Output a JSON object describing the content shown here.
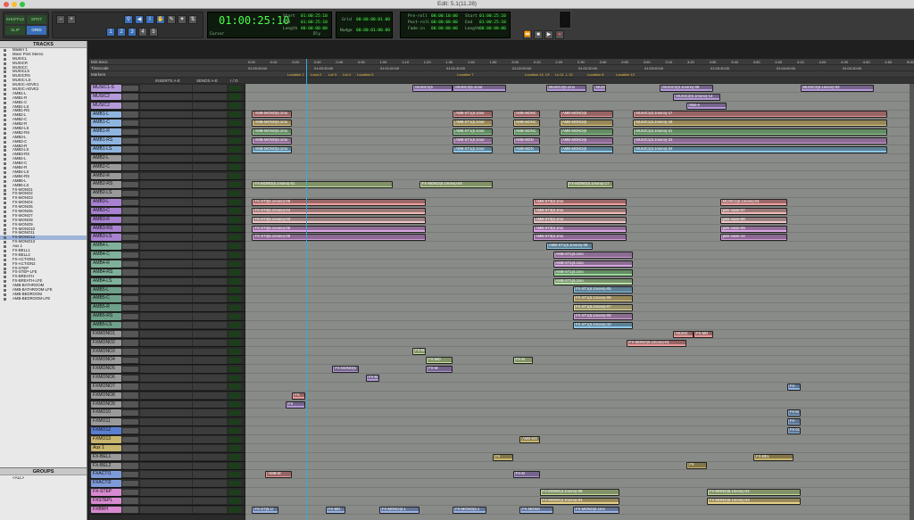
{
  "window": {
    "title": "Edit: 5.1(11.28)"
  },
  "toolbar": {
    "mode_buttons": [
      "SHUFFLE",
      "SPOT",
      "SLIP",
      "GRID"
    ],
    "counter_main": "01:00:25:10",
    "counter_label": "Cursor",
    "sel": {
      "start_label": "Start",
      "end_label": "End",
      "length_label": "Length",
      "start": "01:00:25:10",
      "end": "01:00:25:10",
      "length": "00:00:00:00"
    },
    "dly_label": "Dly",
    "grid_label": "Grid",
    "nudge_label": "Nudge",
    "nudge_value": "00:00:01:00.00",
    "grid_value": "00:00:00:01.00",
    "preroll": {
      "pre_label": "Pre-roll",
      "post_label": "Post-roll",
      "fade_label": "Fade-in",
      "pre": "00:00:10:00",
      "post": "00:00:00:00",
      "fade": "00:00:00:00"
    },
    "transport_sel": {
      "start": "01:00:25:10",
      "end": "01:00:25:10",
      "length": "00:00:00:00"
    }
  },
  "tracks_panel": {
    "header": "TRACKS",
    "items": [
      "Master 1",
      "Mixer Print Stereo",
      "MUSICL",
      "MUSICR",
      "MUSICC",
      "MUSICLS",
      "MUSICRS",
      "MUSIC-LS",
      "MUSIC-ADVE1",
      "MUSIC-ADVE2",
      "AMB1-L",
      "AMB1-R",
      "AMB1-C",
      "AMB1-LS",
      "AMB1-RS",
      "AMB2-L",
      "AMB2-C",
      "AMB2-R",
      "AMB2-LS",
      "AMB2-RS",
      "AMB3-L",
      "AMB3-C",
      "AMB3-R",
      "AMB3-LS",
      "AMB3-RS",
      "AMB4-L",
      "AMB4-C",
      "AMB4-R",
      "AMB4-LS",
      "AMB4-RS",
      "AMB5-L",
      "AMB5-LS",
      "FX-MONO1",
      "FX-MONO2",
      "FX-MONO3",
      "FX-MONO4",
      "FX-MONO5",
      "FX-MONO6",
      "FX-MONO7",
      "FX-MONO8",
      "FX-MONO9",
      "FX-MONO10",
      "FX-MONO11",
      "FX-MONO12",
      "FX-MONO13",
      "Aux 1",
      "FX-BELL1",
      "FX-BELL2",
      "FX-ACTION1",
      "FX-ACTION2",
      "FX-STEP",
      "FX-STEP-LFE",
      "FX-BREATH",
      "FX-BREATH-LFE",
      "AMB-BATHROOM",
      "AMB-BATHROOM-LFE",
      "AMB-BEDROOM",
      "AMB-BEDROOM-LFE"
    ],
    "selected": "FX-MONO12"
  },
  "groups_panel": {
    "header": "GROUPS",
    "items": [
      "<ALL>"
    ]
  },
  "rulers": {
    "min_secs_label": "Min:Secs",
    "timecode_label": "Timecode",
    "markers_label": "Markers",
    "min_secs_ticks": [
      "0:00",
      "0:10",
      "0:20",
      "0:30",
      "0:40",
      "0:50",
      "1:00",
      "1:10",
      "1:20",
      "1:30",
      "1:40",
      "1:50",
      "2:00",
      "2:10",
      "2:20",
      "2:30",
      "2:40",
      "2:50",
      "3:00",
      "3:10",
      "3:20",
      "3:30",
      "3:40",
      "3:50",
      "4:00",
      "4:10",
      "4:20",
      "4:30",
      "4:40",
      "4:50",
      "5:00"
    ],
    "timecode_ticks": [
      "01:00:00:00",
      "01:00:30:00",
      "01:01:00:00",
      "01:01:30:00",
      "01:02:00:00",
      "01:02:30:00",
      "01:03:00:00",
      "01:03:30:00",
      "01:04:00:00",
      "01:04:30:00"
    ],
    "markers": [
      "Location 1",
      "Loca 2",
      "Lot 3",
      "Lot 4",
      "Location 5",
      "Location 7",
      "Location 14",
      "L9",
      "Lo 11",
      "L 12",
      "Location 8",
      "Location 13"
    ]
  },
  "mixer_headers": {
    "inserts": "INSERTS A-E",
    "sends": "SENDS A-E",
    "io": "I / O"
  },
  "edit_tracks": [
    {
      "name": "MUSIC1-S",
      "color": "#b49ad8"
    },
    {
      "name": "MUSIC2",
      "color": "#b49ad8"
    },
    {
      "name": "MUSIC2",
      "color": "#b49ad8"
    },
    {
      "name": "AMB1-L",
      "color": "#8fb4e0"
    },
    {
      "name": "AMB1-C",
      "color": "#8fb4e0"
    },
    {
      "name": "AMB1-R",
      "color": "#8fb4e0"
    },
    {
      "name": "AMB1-RS",
      "color": "#8fb4e0"
    },
    {
      "name": "AMB1-LS",
      "color": "#8fb4e0"
    },
    {
      "name": "AMB2-L",
      "color": "#9a9a9a"
    },
    {
      "name": "AMB2-C",
      "color": "#9a9a9a"
    },
    {
      "name": "AMB2-R",
      "color": "#9a9a9a"
    },
    {
      "name": "AMB2-RS",
      "color": "#9a9a9a"
    },
    {
      "name": "AMB2-LS",
      "color": "#9a9a9a"
    },
    {
      "name": "AMB3-L",
      "color": "#a882d0"
    },
    {
      "name": "AMB3-C",
      "color": "#a882d0"
    },
    {
      "name": "AMB3-R",
      "color": "#a882d0"
    },
    {
      "name": "AMB3-RS",
      "color": "#a882d0"
    },
    {
      "name": "AMB3-LS",
      "color": "#a882d0"
    },
    {
      "name": "AMB4-L",
      "color": "#7fb09a"
    },
    {
      "name": "AMB4-C",
      "color": "#7fb09a"
    },
    {
      "name": "AMB4-R",
      "color": "#7fb09a"
    },
    {
      "name": "AMB4-RS",
      "color": "#7fb09a"
    },
    {
      "name": "AMB4-LS",
      "color": "#7fb09a"
    },
    {
      "name": "AMB5-L",
      "color": "#6fa08a"
    },
    {
      "name": "AMB5-C",
      "color": "#6fa08a"
    },
    {
      "name": "AMB5-R",
      "color": "#6fa08a"
    },
    {
      "name": "AMB5-RS",
      "color": "#6fa08a"
    },
    {
      "name": "AMB5-LS",
      "color": "#6fa08a"
    },
    {
      "name": "FXMONO1",
      "color": "#9a9a9a"
    },
    {
      "name": "FXMONO2",
      "color": "#9a9a9a"
    },
    {
      "name": "FXMONO3",
      "color": "#9a9a9a"
    },
    {
      "name": "FXMONO4",
      "color": "#9a9a9a"
    },
    {
      "name": "FXMONO5",
      "color": "#9a9a9a"
    },
    {
      "name": "FXMONO6",
      "color": "#9a9a9a"
    },
    {
      "name": "FXMONO7",
      "color": "#9a9a9a"
    },
    {
      "name": "FXMONO8",
      "color": "#9a9a9a"
    },
    {
      "name": "FXMONO9",
      "color": "#9a9a9a"
    },
    {
      "name": "FXMO10",
      "color": "#9a9a9a"
    },
    {
      "name": "FXMO11",
      "color": "#9a9a9a"
    },
    {
      "name": "FXMO12",
      "color": "#5a7fd0"
    },
    {
      "name": "FXMO13",
      "color": "#c8b56e"
    },
    {
      "name": "Aux 1",
      "color": "#c8b56e"
    },
    {
      "name": "FX-BEL1",
      "color": "#9a9a9a"
    },
    {
      "name": "FX-BEL2",
      "color": "#9a9a9a"
    },
    {
      "name": "FXACTI1",
      "color": "#7f9ad8"
    },
    {
      "name": "FXACTI2",
      "color": "#7f9ad8"
    },
    {
      "name": "FX-STEP",
      "color": "#d88ad0"
    },
    {
      "name": "FXSTEPL",
      "color": "#d88ad0"
    },
    {
      "name": "FXBRH",
      "color": "#d88ad0"
    }
  ],
  "clips": [
    {
      "row": 0,
      "start": 0.25,
      "width": 0.06,
      "color": "#b49ad8",
      "label": "MUSIC1(5"
    },
    {
      "row": 0,
      "start": 0.31,
      "width": 0.08,
      "color": "#b49ad8",
      "label": "MUSIC2(5.1mor"
    },
    {
      "row": 0,
      "start": 0.45,
      "width": 0.06,
      "color": "#b49ad8",
      "label": "MUSIC2(5.1mo"
    },
    {
      "row": 0,
      "start": 0.52,
      "width": 0.02,
      "color": "#b49ad8",
      "label": "MUSI"
    },
    {
      "row": 0,
      "start": 0.62,
      "width": 0.08,
      "color": "#b49ad8",
      "label": "MUSIC2(5.1mono)-09"
    },
    {
      "row": 0,
      "start": 0.83,
      "width": 0.11,
      "color": "#b49ad8",
      "label": "MUSIC2(5.1mono)-02"
    },
    {
      "row": 1,
      "start": 0.64,
      "width": 0.07,
      "color": "#b49ad8",
      "label": "MUSIC2(5.1mono)-14"
    },
    {
      "row": 2,
      "start": 0.66,
      "width": 0.06,
      "color": "#b49ad8",
      "label": "Mus-e"
    },
    {
      "row": 3,
      "start": 0.01,
      "width": 0.06,
      "color": "#e89a9a",
      "label": "AMB-MONO(5.1mo"
    },
    {
      "row": 3,
      "start": 0.31,
      "width": 0.06,
      "color": "#e89a9a",
      "label": "AMB-ST1(5.1mor"
    },
    {
      "row": 3,
      "start": 0.4,
      "width": 0.04,
      "color": "#e89a9a",
      "label": "AMB-MONC"
    },
    {
      "row": 3,
      "start": 0.47,
      "width": 0.08,
      "color": "#e89a9a",
      "label": "AMB-MONO(5"
    },
    {
      "row": 3,
      "start": 0.58,
      "width": 0.38,
      "color": "#e89a9a",
      "label": "MUSIC1(5.1mono)-17"
    },
    {
      "row": 4,
      "start": 0.01,
      "width": 0.06,
      "color": "#e8d28a",
      "label": "AMB-MONO(5.1mo"
    },
    {
      "row": 4,
      "start": 0.31,
      "width": 0.06,
      "color": "#e8d28a",
      "label": "AMB-ST1(5.1mor"
    },
    {
      "row": 4,
      "start": 0.4,
      "width": 0.04,
      "color": "#e8d28a",
      "label": "AMB-MONC"
    },
    {
      "row": 4,
      "start": 0.47,
      "width": 0.08,
      "color": "#e8d28a",
      "label": "AMB-MONO(5"
    },
    {
      "row": 4,
      "start": 0.58,
      "width": 0.38,
      "color": "#e8d28a",
      "label": "MUSIC1(5.1mono)-18"
    },
    {
      "row": 5,
      "start": 0.01,
      "width": 0.06,
      "color": "#9ad89a",
      "label": "AMB-MONO(5.1mo"
    },
    {
      "row": 5,
      "start": 0.31,
      "width": 0.06,
      "color": "#9ad89a",
      "label": "AMB-ST1(5.1mor"
    },
    {
      "row": 5,
      "start": 0.4,
      "width": 0.04,
      "color": "#9ad89a",
      "label": "AMB-MONC"
    },
    {
      "row": 5,
      "start": 0.47,
      "width": 0.08,
      "color": "#9ad89a",
      "label": "AMB-MONO(5"
    },
    {
      "row": 5,
      "start": 0.58,
      "width": 0.38,
      "color": "#9ad89a",
      "label": "MUSIC1(5.1mono)-21"
    },
    {
      "row": 6,
      "start": 0.01,
      "width": 0.06,
      "color": "#d8a8e0",
      "label": "AMB-MONO(5.1mo"
    },
    {
      "row": 6,
      "start": 0.31,
      "width": 0.06,
      "color": "#d8a8e0",
      "label": "AMB-ST1(5.1mor"
    },
    {
      "row": 6,
      "start": 0.4,
      "width": 0.04,
      "color": "#d8a8e0",
      "label": "AMB-MON"
    },
    {
      "row": 6,
      "start": 0.47,
      "width": 0.08,
      "color": "#d8a8e0",
      "label": "AMB-MONO(5"
    },
    {
      "row": 6,
      "start": 0.58,
      "width": 0.38,
      "color": "#d8a8e0",
      "label": "MUSIC1(5.1mono)-22"
    },
    {
      "row": 7,
      "start": 0.01,
      "width": 0.06,
      "color": "#8fc8e8",
      "label": "AMB-MONO(5.1mo"
    },
    {
      "row": 7,
      "start": 0.31,
      "width": 0.06,
      "color": "#8fc8e8",
      "label": "AMB-ST1(5.1mor"
    },
    {
      "row": 7,
      "start": 0.4,
      "width": 0.04,
      "color": "#8fc8e8",
      "label": "AMB-MON"
    },
    {
      "row": 7,
      "start": 0.47,
      "width": 0.08,
      "color": "#8fc8e8",
      "label": "AMB-MONO(5"
    },
    {
      "row": 7,
      "start": 0.58,
      "width": 0.38,
      "color": "#8fc8e8",
      "label": "MUSIC1(5.1mono)-24"
    },
    {
      "row": 11,
      "start": 0.01,
      "width": 0.21,
      "color": "#c8e0a0",
      "label": "FX-MONO(5.1mono)-01"
    },
    {
      "row": 11,
      "start": 0.26,
      "width": 0.11,
      "color": "#c8e0a0",
      "label": "FX-MONO(5.1mono)-04"
    },
    {
      "row": 11,
      "start": 0.48,
      "width": 0.07,
      "color": "#c8e0a0",
      "label": "FX-MONO(5.1mono)-17"
    },
    {
      "row": 13,
      "start": 0.01,
      "width": 0.26,
      "color": "#f0a0a0",
      "label": "FX-ST3(5.1mono)-09"
    },
    {
      "row": 13,
      "start": 0.43,
      "width": 0.14,
      "color": "#f0a0a0",
      "label": "AMB-ST3(5.1mo"
    },
    {
      "row": 13,
      "start": 0.71,
      "width": 0.1,
      "color": "#f0a0a0",
      "label": "MUSIC1(5.1mono)-01"
    },
    {
      "row": 14,
      "start": 0.01,
      "width": 0.26,
      "color": "#f0b8b8",
      "label": "FX-ST3(5.1mono)-04"
    },
    {
      "row": 14,
      "start": 0.43,
      "width": 0.14,
      "color": "#f0b8b8",
      "label": "AMB-ST3(5.1mo"
    },
    {
      "row": 14,
      "start": 0.71,
      "width": 0.1,
      "color": "#f0b8b8",
      "label": "pink noise-07"
    },
    {
      "row": 15,
      "start": 0.01,
      "width": 0.26,
      "color": "#f0c8c8",
      "label": "FX-ST3(5.1mono)-03"
    },
    {
      "row": 15,
      "start": 0.43,
      "width": 0.14,
      "color": "#f0c8c8",
      "label": "AMB-ST3(5.1mo"
    },
    {
      "row": 15,
      "start": 0.71,
      "width": 0.1,
      "color": "#f0c8c8",
      "label": "pink noise-08"
    },
    {
      "row": 16,
      "start": 0.01,
      "width": 0.26,
      "color": "#e0a8e8",
      "label": "FX-ST3(5.1mono)-05"
    },
    {
      "row": 16,
      "start": 0.43,
      "width": 0.14,
      "color": "#e0a8e8",
      "label": "AMB-ST3(5.1mo"
    },
    {
      "row": 16,
      "start": 0.71,
      "width": 0.1,
      "color": "#e0a8e8",
      "label": "pink noise-09"
    },
    {
      "row": 17,
      "start": 0.01,
      "width": 0.26,
      "color": "#d8a0e0",
      "label": "FX-ST3(5.1mono)-06"
    },
    {
      "row": 17,
      "start": 0.43,
      "width": 0.14,
      "color": "#d8a0e0",
      "label": "AMB-ST3(5.1mo"
    },
    {
      "row": 17,
      "start": 0.71,
      "width": 0.1,
      "color": "#d8a0e0",
      "label": "pink noise-10"
    },
    {
      "row": 18,
      "start": 0.45,
      "width": 0.07,
      "color": "#8fc8e8",
      "label": "AMB-ST1(5.1mono)-09"
    },
    {
      "row": 19,
      "start": 0.46,
      "width": 0.12,
      "color": "#d8a8e0",
      "label": "AMB-ST1(5.1mo"
    },
    {
      "row": 20,
      "start": 0.46,
      "width": 0.12,
      "color": "#d8a8e0",
      "label": "AMB-ST1(5.1mo"
    },
    {
      "row": 21,
      "start": 0.46,
      "width": 0.12,
      "color": "#9ad89a",
      "label": "AMB-ST1(5.1mo"
    },
    {
      "row": 22,
      "start": 0.46,
      "width": 0.12,
      "color": "#b8e0a8",
      "label": "AMB-ST1(5.1mo"
    },
    {
      "row": 23,
      "start": 0.49,
      "width": 0.09,
      "color": "#8fc8e8",
      "label": "FX-ST1(5.1mono)-05"
    },
    {
      "row": 24,
      "start": 0.49,
      "width": 0.09,
      "color": "#e8d28a",
      "label": "FX-ST1(5.1mono)-09"
    },
    {
      "row": 25,
      "start": 0.49,
      "width": 0.09,
      "color": "#e8e0a0",
      "label": "FX-ST1(5.1mono)-07"
    },
    {
      "row": 26,
      "start": 0.49,
      "width": 0.09,
      "color": "#d8a8e0",
      "label": "FX-ST1(5.1mono)-08"
    },
    {
      "row": 27,
      "start": 0.49,
      "width": 0.09,
      "color": "#8fc8e8",
      "label": "FX-ST1(5.1mono)-10"
    },
    {
      "row": 28,
      "start": 0.64,
      "width": 0.03,
      "color": "#e89a9a",
      "label": "MUSIC"
    },
    {
      "row": 28,
      "start": 0.67,
      "width": 0.03,
      "color": "#e89a9a",
      "label": "FX-MO"
    },
    {
      "row": 29,
      "start": 0.57,
      "width": 0.09,
      "color": "#e89a9a",
      "label": "FX-MONO(5.1mono)-01"
    },
    {
      "row": 30,
      "start": 0.25,
      "width": 0.02,
      "color": "#c8e0a0",
      "label": "FX-M"
    },
    {
      "row": 31,
      "start": 0.27,
      "width": 0.04,
      "color": "#c8e0a0",
      "label": "FX-MO"
    },
    {
      "row": 31,
      "start": 0.4,
      "width": 0.03,
      "color": "#c8e0a0",
      "label": "FX-M"
    },
    {
      "row": 32,
      "start": 0.13,
      "width": 0.04,
      "color": "#b49ad8",
      "label": "FX-MONO(5"
    },
    {
      "row": 32,
      "start": 0.27,
      "width": 0.04,
      "color": "#b49ad8",
      "label": "FX-M"
    },
    {
      "row": 33,
      "start": 0.18,
      "width": 0.02,
      "color": "#b49ad8",
      "label": "FX-M"
    },
    {
      "row": 34,
      "start": 0.81,
      "width": 0.02,
      "color": "#8fb4e0",
      "label": "FX-"
    },
    {
      "row": 35,
      "start": 0.07,
      "width": 0.02,
      "color": "#e89a9a",
      "label": "FX"
    },
    {
      "row": 36,
      "start": 0.06,
      "width": 0.03,
      "color": "#b49ad8",
      "label": "FX"
    },
    {
      "row": 37,
      "start": 0.81,
      "width": 0.02,
      "color": "#8fb4e0",
      "label": "FX-M"
    },
    {
      "row": 38,
      "start": 0.81,
      "width": 0.02,
      "color": "#8fb4e0",
      "label": "FX-"
    },
    {
      "row": 39,
      "start": 0.81,
      "width": 0.02,
      "color": "#8fb4e0",
      "label": "FX-01"
    },
    {
      "row": 40,
      "start": 0.41,
      "width": 0.03,
      "color": "#c8b56e",
      "label": "AMB-MO"
    },
    {
      "row": 42,
      "start": 0.37,
      "width": 0.03,
      "color": "#c8b56e",
      "label": "FX"
    },
    {
      "row": 42,
      "start": 0.76,
      "width": 0.06,
      "color": "#c8b56e",
      "label": "FX-BEL"
    },
    {
      "row": 43,
      "start": 0.66,
      "width": 0.03,
      "color": "#c8b56e",
      "label": "FX"
    },
    {
      "row": 44,
      "start": 0.03,
      "width": 0.04,
      "color": "#e89a9a",
      "label": "AMB-M"
    },
    {
      "row": 44,
      "start": 0.4,
      "width": 0.04,
      "color": "#b49ad8",
      "label": "FX-M"
    },
    {
      "row": 46,
      "start": 0.44,
      "width": 0.12,
      "color": "#c8e0a0",
      "label": "FX-MONO(5.1mono)-08"
    },
    {
      "row": 46,
      "start": 0.69,
      "width": 0.14,
      "color": "#c8e0a0",
      "label": "FX-MONO(5.1mono)-22"
    },
    {
      "row": 47,
      "start": 0.44,
      "width": 0.12,
      "color": "#e8d28a",
      "label": "FX-MONO(5.1mono)-04"
    },
    {
      "row": 47,
      "start": 0.69,
      "width": 0.14,
      "color": "#e8d28a",
      "label": "FX-MONO(5.1mono)-23"
    },
    {
      "row": 48,
      "start": 0.01,
      "width": 0.04,
      "color": "#9ab4e8",
      "label": "FX-ST(5.1r"
    },
    {
      "row": 48,
      "start": 0.12,
      "width": 0.03,
      "color": "#9ab4e8",
      "label": "FX-MO"
    },
    {
      "row": 48,
      "start": 0.2,
      "width": 0.06,
      "color": "#9ab4e8",
      "label": "FX-MONO(5.1"
    },
    {
      "row": 48,
      "start": 0.31,
      "width": 0.05,
      "color": "#9ab4e8",
      "label": "FX-MONO(5.1"
    },
    {
      "row": 48,
      "start": 0.41,
      "width": 0.05,
      "color": "#9ab4e8",
      "label": "FX-MONO"
    },
    {
      "row": 48,
      "start": 0.49,
      "width": 0.07,
      "color": "#9ab4e8",
      "label": "FX-MONO(5.1mo"
    }
  ]
}
